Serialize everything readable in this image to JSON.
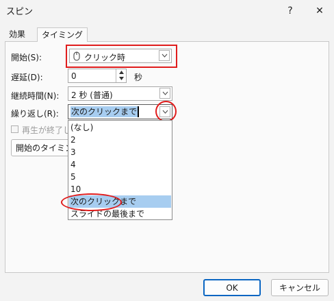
{
  "dialog": {
    "title": "スピン",
    "help_label": "?",
    "close_label": "✕"
  },
  "tabs": [
    {
      "label": "効果"
    },
    {
      "label": "タイミング"
    }
  ],
  "form": {
    "start": {
      "label": "開始(S):",
      "value": "クリック時"
    },
    "delay": {
      "label": "遅延(D):",
      "value": "0",
      "unit": "秒"
    },
    "duration": {
      "label": "継続時間(N):",
      "value": "2 秒 (普通)"
    },
    "repeat": {
      "label": "繰り返し(R):",
      "value": "次のクリックまで"
    },
    "rewind": {
      "label": "再生が終了し"
    },
    "triggers": {
      "label": "開始のタイミング"
    }
  },
  "repeat_options": [
    "(なし)",
    "2",
    "3",
    "4",
    "5",
    "10",
    "次のクリックまで",
    "スライドの最後まで"
  ],
  "repeat_selected_index": 6,
  "footer": {
    "ok_label": "OK",
    "cancel_label": "キャンセル"
  },
  "colors": {
    "highlight": "#e01c1c",
    "selection": "#a7cdf0"
  }
}
